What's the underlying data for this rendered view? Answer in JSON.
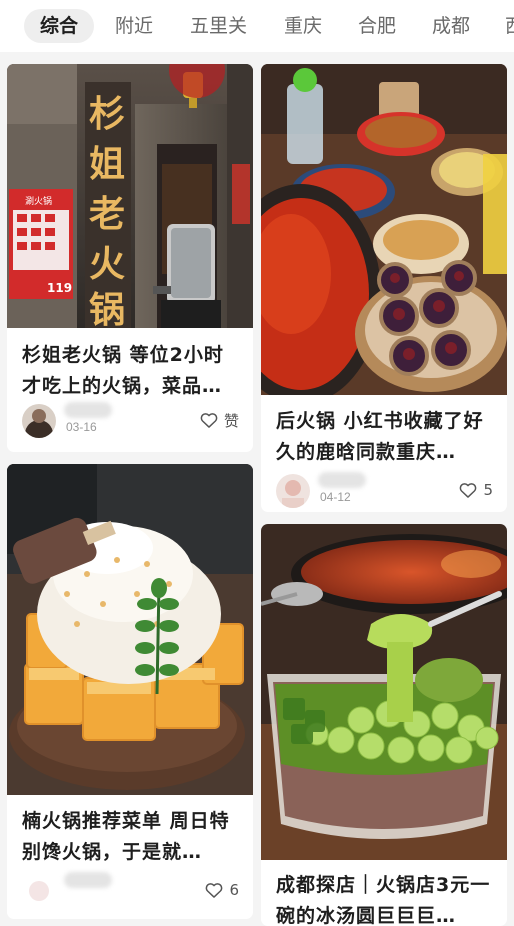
{
  "tabs": [
    "综合",
    "附近",
    "五里关",
    "重庆",
    "合肥",
    "成都",
    "西"
  ],
  "posts": [
    {
      "title": "杉姐老火锅 等位2小时才吃上的火锅，菜品…",
      "date": "03-16",
      "likes": "赞",
      "image_text": {
        "sign": "杉姐老火锅",
        "poster_title": "涮火锅",
        "poster_price": "119"
      }
    },
    {
      "title": "后火锅 小红书收藏了好久的鹿晗同款重庆…",
      "date": "04-12",
      "likes": "5"
    },
    {
      "title": "楠火锅推荐菜单 周日特别馋火锅，于是就…",
      "date": "",
      "likes": "6"
    },
    {
      "title": "成都探店｜火锅店3元一碗的冰汤圆巨巨巨…",
      "date": "",
      "likes": ""
    }
  ],
  "icons": {
    "like": "heart-outline-icon"
  }
}
